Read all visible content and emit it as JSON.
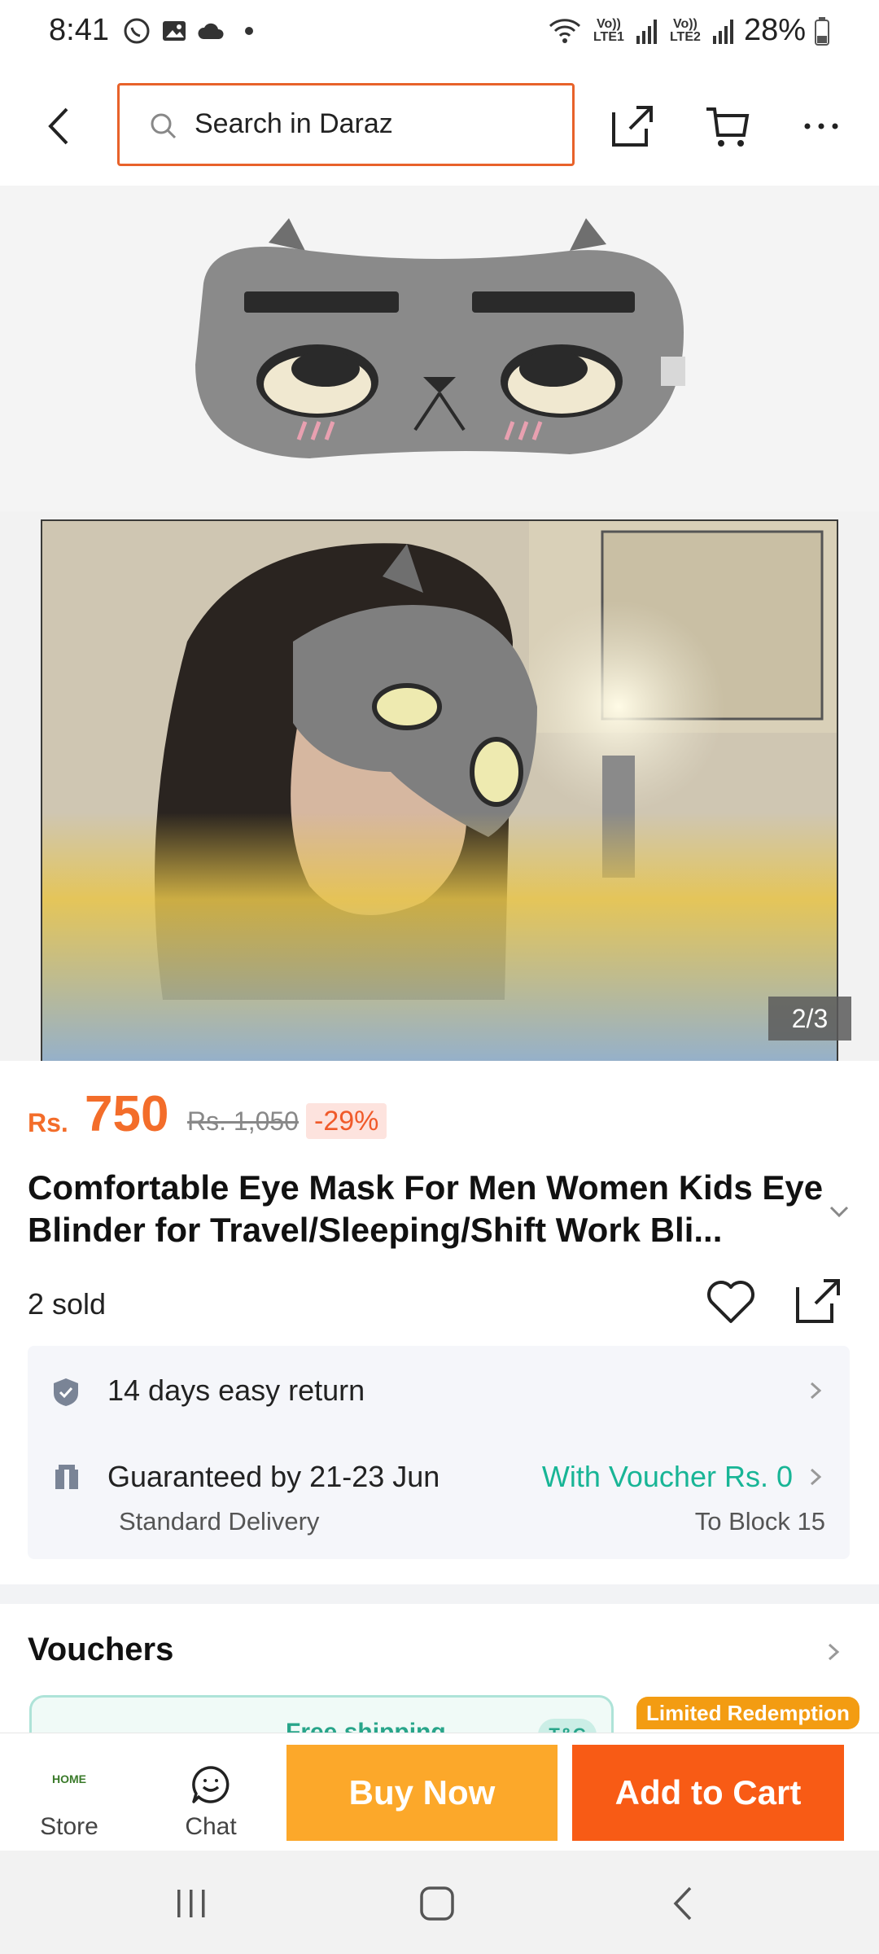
{
  "status_bar": {
    "time": "8:41",
    "lte1": "Vo)) LTE1",
    "lte2": "Vo)) LTE2",
    "battery": "28%"
  },
  "header": {
    "search_placeholder": "Search in Daraz",
    "icons": [
      "back-icon",
      "search-icon",
      "share-icon",
      "cart-icon",
      "more-icon"
    ]
  },
  "gallery": {
    "counter": "2/3",
    "current_index": 2,
    "total": 3
  },
  "product": {
    "currency": "Rs.",
    "price": "750",
    "original_price": "Rs. 1,050",
    "discount": "-29%",
    "title": "Comfortable Eye Mask For Men Women Kids Eye Blinder for Travel/Sleeping/Shift Work Bli...",
    "sold": "2 sold"
  },
  "delivery": {
    "return_text": "14 days easy return",
    "guarantee_text": "Guaranteed by 21-23 Jun",
    "delivery_type": "Standard Delivery",
    "voucher_text": "With Voucher Rs. 0",
    "location": "To Block 15"
  },
  "vouchers": {
    "title": "Vouchers",
    "card_name": "Free shipping",
    "tc_label": "T&C",
    "limited_tag": "Limited Redemption"
  },
  "bottom_bar": {
    "store_label": "Store",
    "store_logo_text": "HOME",
    "chat_label": "Chat",
    "buy_now": "Buy Now",
    "add_to_cart": "Add to Cart"
  },
  "colors": {
    "brand_orange": "#f85b15",
    "buy_yellow": "#fca82a",
    "price_orange": "#f36d2a",
    "voucher_green": "#18b596",
    "search_border": "#e8622a"
  }
}
